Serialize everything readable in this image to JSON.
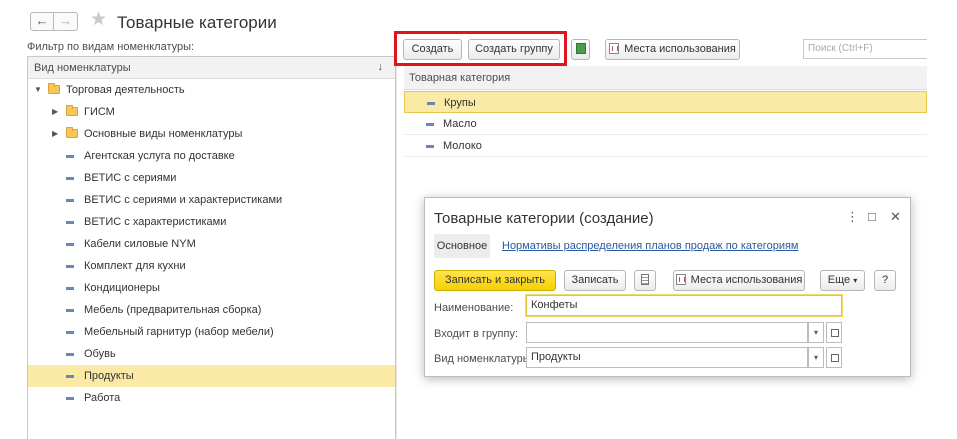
{
  "window": {
    "title": "Товарные категории",
    "filter_label": "Фильтр по видам номенклатуры:"
  },
  "nav": {
    "back": "←",
    "forward": "→"
  },
  "left_panel": {
    "header": "Вид номенклатуры",
    "sort_indicator": "↓",
    "rows": [
      {
        "label": "Торговая деятельность",
        "type": "folder",
        "level": 0,
        "expanded": true
      },
      {
        "label": "ГИСМ",
        "type": "folder",
        "level": 1,
        "expanded": false
      },
      {
        "label": "Основные виды номенклатуры",
        "type": "folder",
        "level": 1,
        "expanded": false
      },
      {
        "label": "Агентская услуга по доставке",
        "type": "item",
        "level": 1
      },
      {
        "label": "ВЕТИС с сериями",
        "type": "item",
        "level": 1
      },
      {
        "label": "ВЕТИС с сериями и характеристиками",
        "type": "item",
        "level": 1
      },
      {
        "label": "ВЕТИС с характеристиками",
        "type": "item",
        "level": 1
      },
      {
        "label": "Кабели силовые NYM",
        "type": "item",
        "level": 1
      },
      {
        "label": "Комплект для кухни",
        "type": "item",
        "level": 1
      },
      {
        "label": "Кондиционеры",
        "type": "item",
        "level": 1
      },
      {
        "label": "Мебель (предварительная сборка)",
        "type": "item",
        "level": 1
      },
      {
        "label": "Мебельный гарнитур (набор мебели)",
        "type": "item",
        "level": 1
      },
      {
        "label": "Обувь",
        "type": "item",
        "level": 1
      },
      {
        "label": "Продукты",
        "type": "item",
        "level": 1,
        "selected": true
      },
      {
        "label": "Работа",
        "type": "item",
        "level": 1
      }
    ]
  },
  "toolbar": {
    "create": "Создать",
    "create_group": "Создать группу",
    "usage_places": "Места использования",
    "search_placeholder": "Поиск (Ctrl+F)"
  },
  "right_list": {
    "header": "Товарная категория",
    "rows": [
      {
        "label": "Крупы",
        "selected": true
      },
      {
        "label": "Масло",
        "selected": false
      },
      {
        "label": "Молоко",
        "selected": false
      }
    ]
  },
  "dialog": {
    "title": "Товарные категории (создание)",
    "menu_icon": "⋮",
    "maximize_icon": "□",
    "close_icon": "✕",
    "tab_main": "Основное",
    "tab_link": "Нормативы распределения планов продаж по категориям",
    "save_close": "Записать и закрыть",
    "save": "Записать",
    "usage_places": "Места использования",
    "more": "Еще",
    "more_arrow": "▾",
    "help": "?",
    "name_label": "Наименование:",
    "name_value": "Конфеты",
    "group_label": "Входит в группу:",
    "group_value": "",
    "kind_label": "Вид номенклатуры:",
    "kind_value": "Продукты"
  },
  "colors": {
    "selection": "#fbeaa6",
    "accent_yellow": "#f5d100",
    "highlight_red": "#e0141e",
    "link": "#2b5a9e"
  }
}
